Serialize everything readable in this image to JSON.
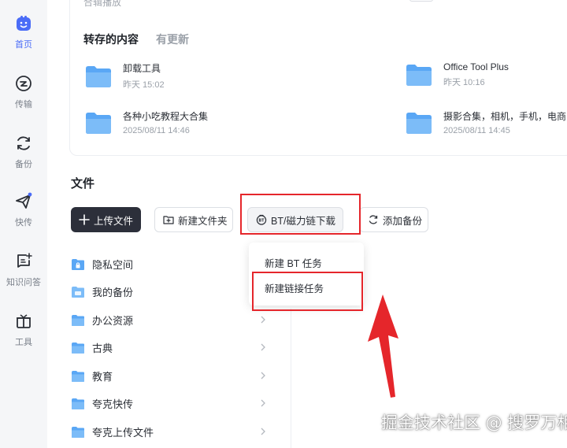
{
  "colors": {
    "accent": "#4a6cf7",
    "highlight": "#e5262b",
    "upload_button": "#2c2f3a",
    "folder": "#5aa7f5"
  },
  "sidebar": {
    "items": [
      {
        "label": "首页",
        "icon": "home-smile-icon",
        "active": true
      },
      {
        "label": "传输",
        "icon": "transfer-icon",
        "active": false
      },
      {
        "label": "备份",
        "icon": "backup-sync-icon",
        "active": false
      },
      {
        "label": "快传",
        "icon": "send-plane-icon",
        "active": false
      },
      {
        "label": "知识问答",
        "icon": "qa-icon",
        "active": false
      },
      {
        "label": "工具",
        "icon": "toolbox-icon",
        "active": false
      }
    ]
  },
  "top_card": {
    "clipped_text": "合辑播放",
    "tabs": {
      "active": "转存的内容",
      "other": "有更新"
    },
    "saved_items": [
      {
        "name": "卸载工具",
        "time": "昨天 15:02"
      },
      {
        "name": "Office Tool Plus",
        "time": "昨天 10:16"
      },
      {
        "name": "各种小吃教程大合集",
        "time": "2025/08/11 14:46"
      },
      {
        "name": "摄影合集，相机，手机，电商",
        "time": "2025/08/11 14:45"
      }
    ]
  },
  "files": {
    "title": "文件",
    "toolbar": {
      "upload": "上传文件",
      "new_folder": "新建文件夹",
      "bt_download": "BT/磁力链下载",
      "add_backup": "添加备份"
    },
    "dropdown": {
      "items": [
        "新建 BT 任务",
        "新建链接任务"
      ]
    },
    "list": [
      {
        "label": "隐私空间",
        "icon": "lock-folder-icon"
      },
      {
        "label": "我的备份",
        "icon": "backup-folder-icon"
      },
      {
        "label": "办公资源",
        "icon": "folder-icon"
      },
      {
        "label": "古典",
        "icon": "folder-icon"
      },
      {
        "label": "教育",
        "icon": "folder-icon"
      },
      {
        "label": "夸克快传",
        "icon": "folder-icon"
      },
      {
        "label": "夸克上传文件",
        "icon": "folder-icon"
      }
    ]
  },
  "watermark": "掘金技术社区 @ 搜罗万相"
}
